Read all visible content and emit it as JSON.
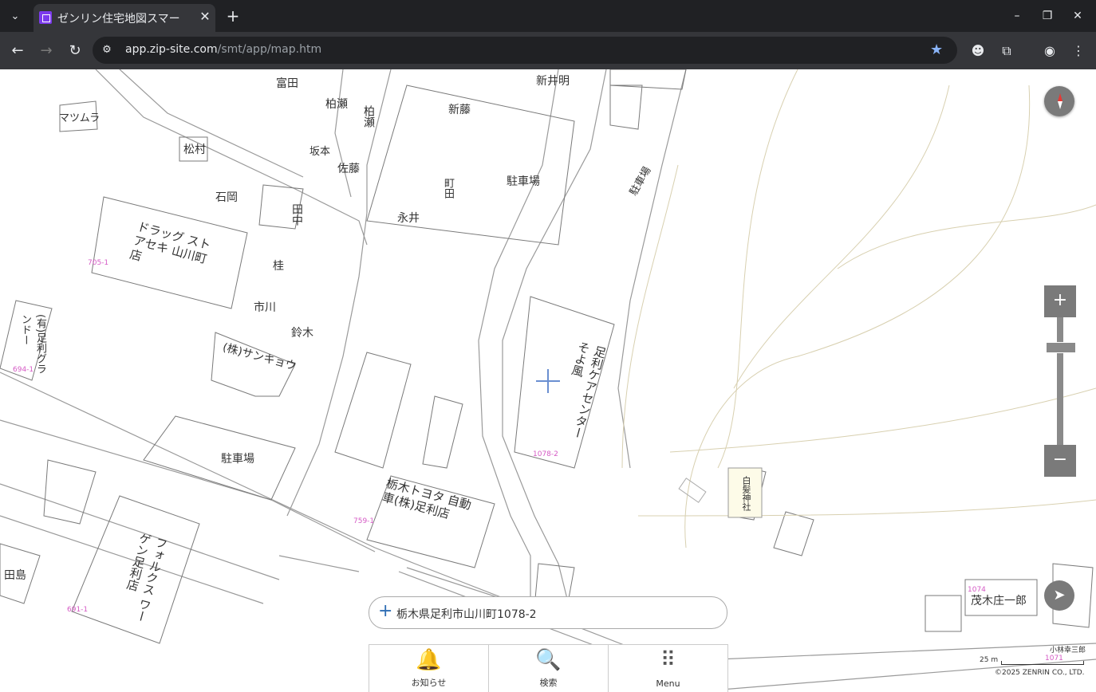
{
  "browser": {
    "tab_title": "ゼンリン住宅地図スマー",
    "tab_close": "✕",
    "new_tab": "+",
    "url_host": "app.zip-site.com",
    "url_path": "/smt/app/map.htm"
  },
  "map": {
    "address": "栃木県足利市山川町1078-2",
    "scale_label": "25 m",
    "copyright": "©2025 ZENRIN CO., LTD.",
    "labels": {
      "tomita": "富田",
      "matsumura": "マツムラ",
      "matsumura2": "松村",
      "kashiwase": "柏瀬",
      "kashiwase2": "柏瀬",
      "sakamoto": "坂本",
      "sato": "佐藤",
      "shinfuji": "新藤",
      "shinimei": "新井明",
      "ishioka": "石岡",
      "tanaka": "田中",
      "katsura": "桂",
      "ichikawa": "市川",
      "suzuki": "鈴木",
      "drugstore": "ドラッグ ストアセキ 山川町店",
      "sankyo": "(株)サンキョウ",
      "parking1": "駐車場",
      "parking2": "駐車場",
      "parking3": "駐車場",
      "nagai": "永井",
      "machida": "町田",
      "care_center": "足利ケアセンターそよ風",
      "toyota": "栃木トヨタ 自動車(株)足利店",
      "volkswagen": "フォルクス ワーゲン足利店",
      "tajima": "田島",
      "shrine": "白髪神社",
      "moki": "茂木庄一郎",
      "ashikaga_grand": "(有)足利グランドー",
      "kobayashi": "小林幸三郎"
    },
    "lots": {
      "l705": "705-1",
      "l1078": "1078-2",
      "l759": "759-1",
      "l694": "694-1",
      "l691": "691-1",
      "l1074": "1074",
      "l1071": "1071"
    }
  },
  "menu": {
    "notice": "お知らせ",
    "search": "検索",
    "menu": "Menu"
  }
}
